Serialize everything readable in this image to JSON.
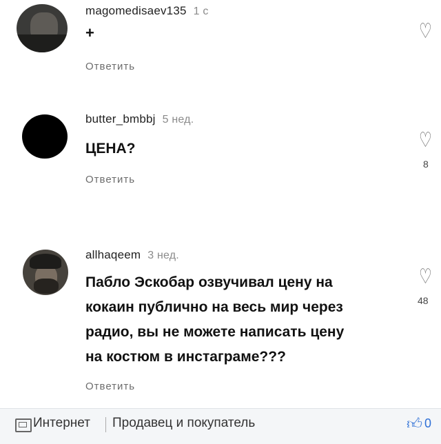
{
  "comments": [
    {
      "username": "magomedisaev135",
      "time": "1 c",
      "text": "+",
      "reply": "Ответить",
      "likes": ""
    },
    {
      "username": "butter_bmbbj",
      "time": "5 нед.",
      "text": "ЦЕНА?",
      "reply": "Ответить",
      "likes": "8"
    },
    {
      "username": "allhaqeem",
      "time": "3 нед.",
      "text_lines": [
        "Пабло Эскобар озвучивал цену на",
        "кокаин публично на весь мир через",
        "радио, вы не можете написать цену",
        "на костюм в инстаграме???"
      ],
      "reply": "Ответить",
      "likes": "48"
    }
  ],
  "bottom_bar": {
    "source": "Интернет",
    "category": "Продавец и покупатель",
    "like_count": "0"
  },
  "colors": {
    "accent": "#2d6fd6",
    "muted_text": "#6c6c6c"
  }
}
